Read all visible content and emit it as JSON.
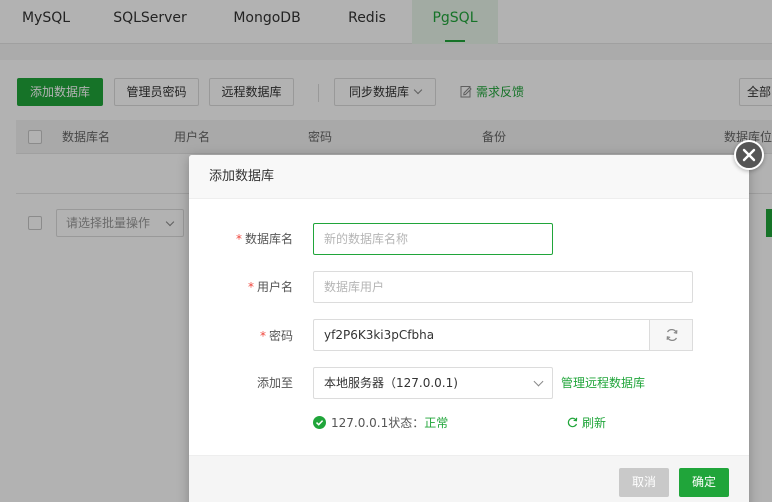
{
  "tabs": [
    "MySQL",
    "SQLServer",
    "MongoDB",
    "Redis",
    "PgSQL"
  ],
  "toolbar": {
    "add_db": "添加数据库",
    "admin_pwd": "管理员密码",
    "remote_db": "远程数据库",
    "sync_db": "同步数据库",
    "feedback": "需求反馈",
    "all": "全部"
  },
  "table": {
    "headers": [
      "数据库名",
      "用户名",
      "密码",
      "备份",
      "数据库位"
    ]
  },
  "batch": {
    "placeholder": "请选择批量操作"
  },
  "modal": {
    "title": "添加数据库",
    "db_name_label": "数据库名",
    "db_name_placeholder": "新的数据库名称",
    "user_label": "用户名",
    "user_placeholder": "数据库用户",
    "pwd_label": "密码",
    "pwd_value": "yf2P6K3ki3pCfbha",
    "add_to_label": "添加至",
    "server_value": "本地服务器（127.0.0.1)",
    "manage_remote": "管理远程数据库",
    "status_prefix": "127.0.0.1状态：",
    "status_value": "正常",
    "refresh": "刷新",
    "cancel": "取消",
    "confirm": "确定"
  },
  "colors": {
    "accent": "#20a53a",
    "required": "#f0463c"
  }
}
